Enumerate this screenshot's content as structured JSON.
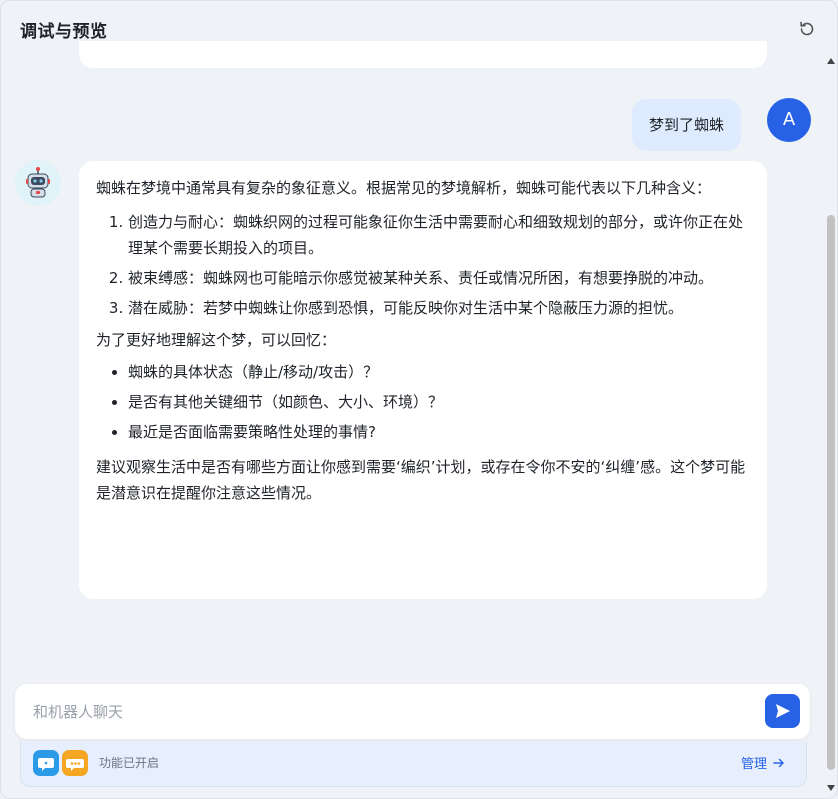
{
  "header": {
    "title": "调试与预览",
    "refresh_icon": "refresh-icon"
  },
  "conversation": {
    "user_avatar_letter": "A",
    "user_message": "梦到了蜘蛛",
    "bot_avatar_icon": "robot-icon",
    "bot_message": {
      "intro": "蜘蛛在梦境中通常具有复杂的象征意义。根据常见的梦境解析，蜘蛛可能代表以下几种含义：",
      "ordered_items": [
        "创造力与耐心：蜘蛛织网的过程可能象征你生活中需要耐心和细致规划的部分，或许你正在处理某个需要长期投入的项目。",
        "被束缚感：蜘蛛网也可能暗示你感觉被某种关系、责任或情况所困，有想要挣脱的冲动。",
        "潜在威胁：若梦中蜘蛛让你感到恐惧，可能反映你对生活中某个隐蔽压力源的担忧。"
      ],
      "followup_intro": "为了更好地理解这个梦，可以回忆：",
      "bullet_items": [
        "蜘蛛的具体状态（静止/移动/攻击）？",
        "是否有其他关键细节（如颜色、大小、环境）？",
        "最近是否面临需要策略性处理的事情?"
      ],
      "conclusion": "建议观察生活中是否有哪些方面让你感到需要‘编织’计划，或存在令你不安的‘纠缠’感。这个梦可能是潜意识在提醒你注意这些情况。"
    }
  },
  "composer": {
    "placeholder": "和机器人聊天",
    "value": "",
    "send_icon": "send-icon"
  },
  "features": {
    "icons": [
      "chat-bubble-icon",
      "more-dots-icon"
    ],
    "label": "功能已开启",
    "manage_label": "管理",
    "manage_icon": "arrow-right-icon"
  },
  "colors": {
    "accent": "#2762e6",
    "user_bubble": "#deebff",
    "background": "#eff2f7"
  }
}
